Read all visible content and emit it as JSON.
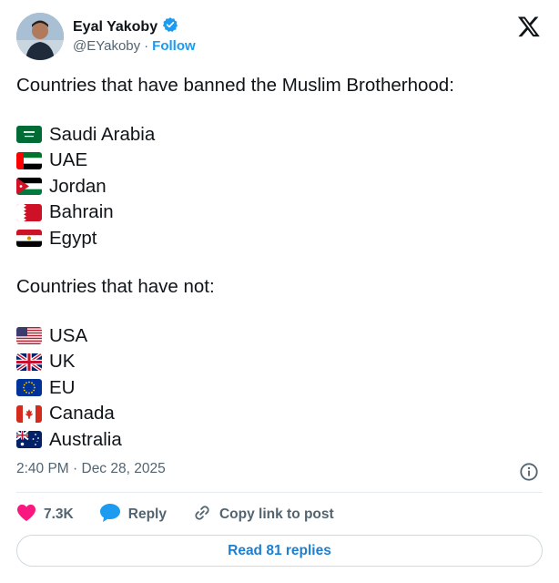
{
  "author": {
    "name": "Eyal Yakoby",
    "handle": "@EYakoby",
    "separator": "·",
    "follow_label": "Follow",
    "verified_color": "#1d9bf0"
  },
  "post": {
    "intro": "Countries that have banned the Muslim Brotherhood:",
    "banned": [
      {
        "flag": "saudi-arabia-flag-icon",
        "label": "Saudi Arabia"
      },
      {
        "flag": "uae-flag-icon",
        "label": "UAE"
      },
      {
        "flag": "jordan-flag-icon",
        "label": "Jordan"
      },
      {
        "flag": "bahrain-flag-icon",
        "label": "Bahrain"
      },
      {
        "flag": "egypt-flag-icon",
        "label": "Egypt"
      }
    ],
    "not_heading": "Countries that have not:",
    "not_banned": [
      {
        "flag": "usa-flag-icon",
        "label": "USA"
      },
      {
        "flag": "uk-flag-icon",
        "label": "UK"
      },
      {
        "flag": "eu-flag-icon",
        "label": "EU"
      },
      {
        "flag": "canada-flag-icon",
        "label": "Canada"
      },
      {
        "flag": "australia-flag-icon",
        "label": "Australia"
      }
    ]
  },
  "meta": {
    "timestamp": "2:40 PM · Dec 28, 2025"
  },
  "actions": {
    "likes": "7.3K",
    "reply_label": "Reply",
    "copy_label": "Copy link to post",
    "like_color": "#f91880",
    "reply_color": "#1d9bf0"
  },
  "replies_button": {
    "label": "Read 81 replies"
  }
}
